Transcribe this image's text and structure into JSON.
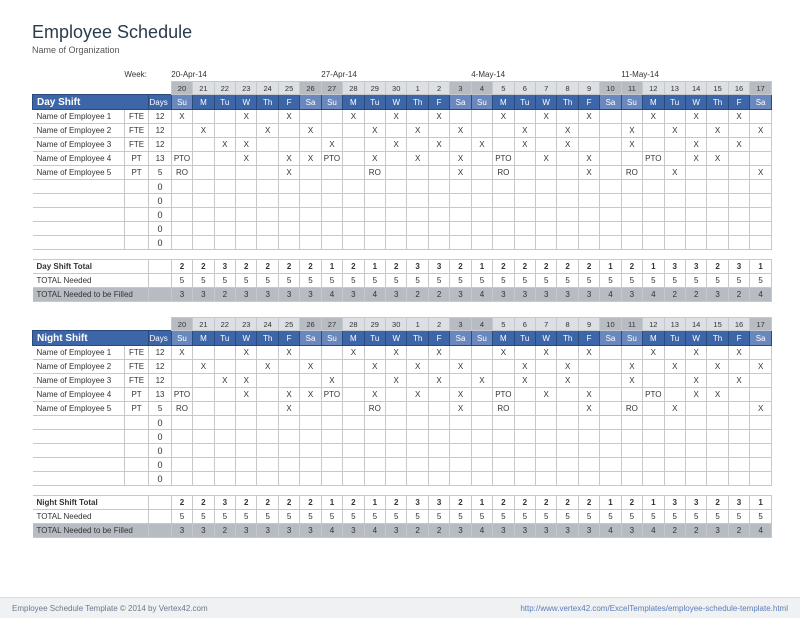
{
  "title": "Employee Schedule",
  "org": "Name of Organization",
  "week_label": "Week:",
  "week_starts": [
    "20-Apr-14",
    "27-Apr-14",
    "4-May-14",
    "11-May-14"
  ],
  "date_nums": [
    20,
    21,
    22,
    23,
    24,
    25,
    26,
    27,
    28,
    29,
    30,
    1,
    2,
    3,
    4,
    5,
    6,
    7,
    8,
    9,
    10,
    11,
    12,
    13,
    14,
    15,
    16,
    17
  ],
  "dow": [
    "Su",
    "M",
    "Tu",
    "W",
    "Th",
    "F",
    "Sa",
    "Su",
    "M",
    "Tu",
    "W",
    "Th",
    "F",
    "Sa",
    "Su",
    "M",
    "Tu",
    "W",
    "Th",
    "F",
    "Sa",
    "Su",
    "M",
    "Tu",
    "W",
    "Th",
    "F",
    "Sa"
  ],
  "weekend_idx": [
    0,
    6,
    7,
    13,
    14,
    20,
    21,
    27
  ],
  "days_hd": "Days",
  "shifts": [
    {
      "name": "Day Shift",
      "rows": [
        {
          "nm": "Name of Employee 1",
          "fte": "FTE",
          "days": "12",
          "cells": [
            "X",
            "",
            "",
            "X",
            "",
            "X",
            "",
            "",
            "X",
            "",
            "X",
            "",
            "X",
            "",
            "",
            "X",
            "",
            "X",
            "",
            "X",
            "",
            "",
            "X",
            "",
            "X",
            "",
            "X",
            ""
          ]
        },
        {
          "nm": "Name of Employee 2",
          "fte": "FTE",
          "days": "12",
          "cells": [
            "",
            "X",
            "",
            "",
            "X",
            "",
            "X",
            "",
            "",
            "X",
            "",
            "X",
            "",
            "X",
            "",
            "",
            "X",
            "",
            "X",
            "",
            "",
            "X",
            "",
            "X",
            "",
            "X",
            "",
            "X"
          ]
        },
        {
          "nm": "Name of Employee 3",
          "fte": "FTE",
          "days": "12",
          "cells": [
            "",
            "",
            "X",
            "X",
            "",
            "",
            "",
            "X",
            "",
            "",
            "X",
            "",
            "X",
            "",
            "X",
            "",
            "X",
            "",
            "X",
            "",
            "",
            "X",
            "",
            "",
            "X",
            "",
            "X",
            ""
          ]
        },
        {
          "nm": "Name of Employee 4",
          "fte": "PT",
          "days": "13",
          "cells": [
            "PTO",
            "",
            "",
            "X",
            "",
            "X",
            "X",
            "PTO",
            "",
            "X",
            "",
            "X",
            "",
            "X",
            "",
            "PTO",
            "",
            "X",
            "",
            "X",
            "",
            "",
            "PTO",
            "",
            "X",
            "X",
            "",
            ""
          ]
        },
        {
          "nm": "Name of Employee 5",
          "fte": "PT",
          "days": "5",
          "cells": [
            "RO",
            "",
            "",
            "",
            "",
            "X",
            "",
            "",
            "",
            "RO",
            "",
            "",
            "",
            "X",
            "",
            "RO",
            "",
            "",
            "",
            "X",
            "",
            "RO",
            "",
            "X",
            "",
            "",
            "",
            "X"
          ]
        }
      ],
      "blank_rows": 5,
      "total": {
        "label": "Day Shift Total",
        "vals": [
          2,
          2,
          3,
          2,
          2,
          2,
          2,
          1,
          2,
          1,
          2,
          3,
          3,
          2,
          1,
          2,
          2,
          2,
          2,
          2,
          1,
          2,
          1,
          3,
          3,
          2,
          3,
          1
        ]
      },
      "needed": {
        "label": "TOTAL Needed",
        "vals": [
          5,
          5,
          5,
          5,
          5,
          5,
          5,
          5,
          5,
          5,
          5,
          5,
          5,
          5,
          5,
          5,
          5,
          5,
          5,
          5,
          5,
          5,
          5,
          5,
          5,
          5,
          5,
          5
        ]
      },
      "fill": {
        "label": "TOTAL Needed to be Filled",
        "vals": [
          3,
          3,
          2,
          3,
          3,
          3,
          3,
          4,
          3,
          4,
          3,
          2,
          2,
          3,
          4,
          3,
          3,
          3,
          3,
          3,
          4,
          3,
          4,
          2,
          2,
          3,
          2,
          4
        ]
      }
    },
    {
      "name": "Night Shift",
      "rows": [
        {
          "nm": "Name of Employee 1",
          "fte": "FTE",
          "days": "12",
          "cells": [
            "X",
            "",
            "",
            "X",
            "",
            "X",
            "",
            "",
            "X",
            "",
            "X",
            "",
            "X",
            "",
            "",
            "X",
            "",
            "X",
            "",
            "X",
            "",
            "",
            "X",
            "",
            "X",
            "",
            "X",
            ""
          ]
        },
        {
          "nm": "Name of Employee 2",
          "fte": "FTE",
          "days": "12",
          "cells": [
            "",
            "X",
            "",
            "",
            "X",
            "",
            "X",
            "",
            "",
            "X",
            "",
            "X",
            "",
            "X",
            "",
            "",
            "X",
            "",
            "X",
            "",
            "",
            "X",
            "",
            "X",
            "",
            "X",
            "",
            "X"
          ]
        },
        {
          "nm": "Name of Employee 3",
          "fte": "FTE",
          "days": "12",
          "cells": [
            "",
            "",
            "X",
            "X",
            "",
            "",
            "",
            "X",
            "",
            "",
            "X",
            "",
            "X",
            "",
            "X",
            "",
            "X",
            "",
            "X",
            "",
            "",
            "X",
            "",
            "",
            "X",
            "",
            "X",
            ""
          ]
        },
        {
          "nm": "Name of Employee 4",
          "fte": "PT",
          "days": "13",
          "cells": [
            "PTO",
            "",
            "",
            "X",
            "",
            "X",
            "X",
            "PTO",
            "",
            "X",
            "",
            "X",
            "",
            "X",
            "",
            "PTO",
            "",
            "X",
            "",
            "X",
            "",
            "",
            "PTO",
            "",
            "X",
            "X",
            "",
            ""
          ]
        },
        {
          "nm": "Name of Employee 5",
          "fte": "PT",
          "days": "5",
          "cells": [
            "RO",
            "",
            "",
            "",
            "",
            "X",
            "",
            "",
            "",
            "RO",
            "",
            "",
            "",
            "X",
            "",
            "RO",
            "",
            "",
            "",
            "X",
            "",
            "RO",
            "",
            "X",
            "",
            "",
            "",
            "X"
          ]
        }
      ],
      "blank_rows": 5,
      "total": {
        "label": "Night Shift Total",
        "vals": [
          2,
          2,
          3,
          2,
          2,
          2,
          2,
          1,
          2,
          1,
          2,
          3,
          3,
          2,
          1,
          2,
          2,
          2,
          2,
          2,
          1,
          2,
          1,
          3,
          3,
          2,
          3,
          1
        ]
      },
      "needed": {
        "label": "TOTAL Needed",
        "vals": [
          5,
          5,
          5,
          5,
          5,
          5,
          5,
          5,
          5,
          5,
          5,
          5,
          5,
          5,
          5,
          5,
          5,
          5,
          5,
          5,
          5,
          5,
          5,
          5,
          5,
          5,
          5,
          5
        ]
      },
      "fill": {
        "label": "TOTAL Needed to be Filled",
        "vals": [
          3,
          3,
          2,
          3,
          3,
          3,
          3,
          4,
          3,
          4,
          3,
          2,
          2,
          3,
          4,
          3,
          3,
          3,
          3,
          3,
          4,
          3,
          4,
          2,
          2,
          3,
          2,
          4
        ]
      }
    }
  ],
  "footer": {
    "copyright": "Employee Schedule Template © 2014 by Vertex42.com",
    "url": "http://www.vertex42.com/ExcelTemplates/employee-schedule-template.html"
  }
}
